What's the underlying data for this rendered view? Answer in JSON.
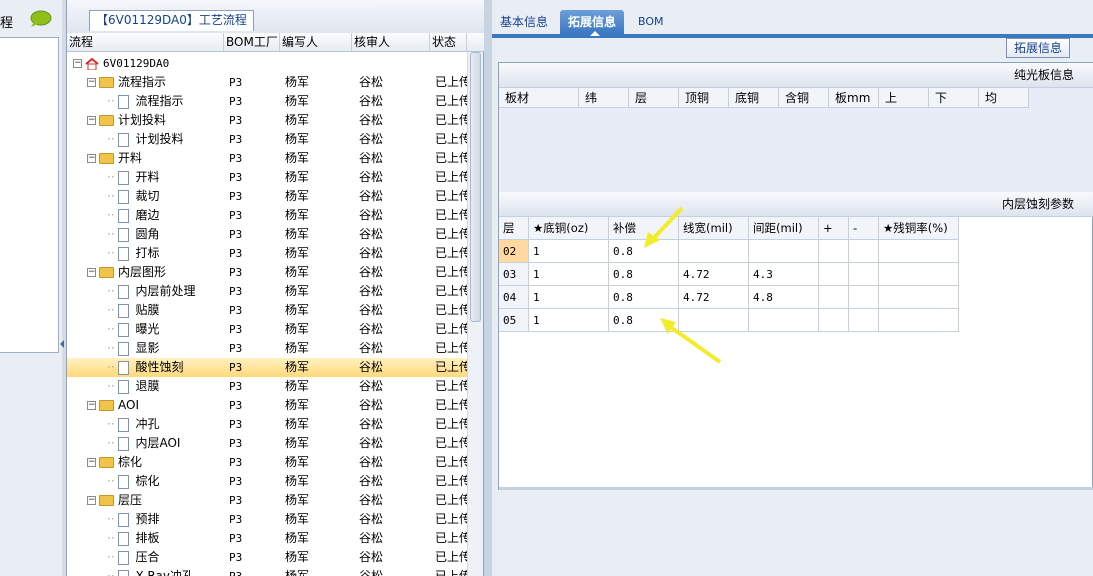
{
  "left_panel": {
    "label": "程",
    "chat_icon": "speech-bubble-icon"
  },
  "tree": {
    "title": "【6V01129DA0】工艺流程",
    "columns": [
      "流程",
      "BOM工厂",
      "编写人",
      "核审人",
      "状态"
    ],
    "root": "6V01129DA0",
    "rows": [
      {
        "label": "流程指示",
        "type": "folder",
        "bom": "P3",
        "author": "杨军",
        "reviewer": "谷松",
        "status": "已上传"
      },
      {
        "label": "流程指示",
        "type": "doc",
        "bom": "P3",
        "author": "杨军",
        "reviewer": "谷松",
        "status": "已上传"
      },
      {
        "label": "计划投料",
        "type": "folder",
        "bom": "P3",
        "author": "杨军",
        "reviewer": "谷松",
        "status": "已上传"
      },
      {
        "label": "计划投料",
        "type": "doc",
        "bom": "P3",
        "author": "杨军",
        "reviewer": "谷松",
        "status": "已上传"
      },
      {
        "label": "开料",
        "type": "folder",
        "bom": "P3",
        "author": "杨军",
        "reviewer": "谷松",
        "status": "已上传"
      },
      {
        "label": "开料",
        "type": "doc",
        "bom": "P3",
        "author": "杨军",
        "reviewer": "谷松",
        "status": "已上传"
      },
      {
        "label": "裁切",
        "type": "doc",
        "bom": "P3",
        "author": "杨军",
        "reviewer": "谷松",
        "status": "已上传"
      },
      {
        "label": "磨边",
        "type": "doc",
        "bom": "P3",
        "author": "杨军",
        "reviewer": "谷松",
        "status": "已上传"
      },
      {
        "label": "圆角",
        "type": "doc",
        "bom": "P3",
        "author": "杨军",
        "reviewer": "谷松",
        "status": "已上传"
      },
      {
        "label": "打标",
        "type": "doc",
        "bom": "P3",
        "author": "杨军",
        "reviewer": "谷松",
        "status": "已上传"
      },
      {
        "label": "内层图形",
        "type": "folder",
        "bom": "P3",
        "author": "杨军",
        "reviewer": "谷松",
        "status": "已上传"
      },
      {
        "label": "内层前处理",
        "type": "doc",
        "bom": "P3",
        "author": "杨军",
        "reviewer": "谷松",
        "status": "已上传"
      },
      {
        "label": "贴膜",
        "type": "doc",
        "bom": "P3",
        "author": "杨军",
        "reviewer": "谷松",
        "status": "已上传"
      },
      {
        "label": "曝光",
        "type": "doc",
        "bom": "P3",
        "author": "杨军",
        "reviewer": "谷松",
        "status": "已上传"
      },
      {
        "label": "显影",
        "type": "doc",
        "bom": "P3",
        "author": "杨军",
        "reviewer": "谷松",
        "status": "已上传"
      },
      {
        "label": "酸性蚀刻",
        "type": "doc",
        "bom": "P3",
        "author": "杨军",
        "reviewer": "谷松",
        "status": "已上传",
        "selected": true
      },
      {
        "label": "退膜",
        "type": "doc",
        "bom": "P3",
        "author": "杨军",
        "reviewer": "谷松",
        "status": "已上传"
      },
      {
        "label": "AOI",
        "type": "folder",
        "bom": "P3",
        "author": "杨军",
        "reviewer": "谷松",
        "status": "已上传"
      },
      {
        "label": "冲孔",
        "type": "doc",
        "bom": "P3",
        "author": "杨军",
        "reviewer": "谷松",
        "status": "已上传"
      },
      {
        "label": "内层AOI",
        "type": "doc",
        "bom": "P3",
        "author": "杨军",
        "reviewer": "谷松",
        "status": "已上传"
      },
      {
        "label": "棕化",
        "type": "folder",
        "bom": "P3",
        "author": "杨军",
        "reviewer": "谷松",
        "status": "已上传"
      },
      {
        "label": "棕化",
        "type": "doc",
        "bom": "P3",
        "author": "杨军",
        "reviewer": "谷松",
        "status": "已上传"
      },
      {
        "label": "层压",
        "type": "folder",
        "bom": "P3",
        "author": "杨军",
        "reviewer": "谷松",
        "status": "已上传"
      },
      {
        "label": "预排",
        "type": "doc",
        "bom": "P3",
        "author": "杨军",
        "reviewer": "谷松",
        "status": "已上传"
      },
      {
        "label": "排板",
        "type": "doc",
        "bom": "P3",
        "author": "杨军",
        "reviewer": "谷松",
        "status": "已上传"
      },
      {
        "label": "压合",
        "type": "doc",
        "bom": "P3",
        "author": "杨军",
        "reviewer": "谷松",
        "status": "已上传"
      },
      {
        "label": "X-Ray冲孔",
        "type": "doc",
        "bom": "P3",
        "author": "杨军",
        "reviewer": "谷松",
        "status": "已上传"
      }
    ]
  },
  "right": {
    "tabs": [
      "基本信息",
      "拓展信息",
      "BOM"
    ],
    "active_tab": 1,
    "ext_button": "拓展信息",
    "section1": {
      "title": "纯光板信息",
      "columns": [
        "板材",
        "纬",
        "层",
        "顶铜",
        "底铜",
        "含铜",
        "板mm",
        "上",
        "下",
        "均"
      ]
    },
    "section2": {
      "title": "内层蚀刻参数",
      "columns": [
        "层",
        "★底铜(oz)",
        "补偿",
        "线宽(mil)",
        "间距(mil)",
        "+",
        "-",
        "★残铜率(%)"
      ],
      "rows": [
        {
          "layer": "02",
          "base_cu": "1",
          "comp": "0.8",
          "width": "",
          "spacing": "",
          "plus": "",
          "minus": "",
          "residual": "",
          "highlight": true
        },
        {
          "layer": "03",
          "base_cu": "1",
          "comp": "0.8",
          "width": "4.72",
          "spacing": "4.3",
          "plus": "",
          "minus": "",
          "residual": ""
        },
        {
          "layer": "04",
          "base_cu": "1",
          "comp": "0.8",
          "width": "4.72",
          "spacing": "4.8",
          "plus": "",
          "minus": "",
          "residual": ""
        },
        {
          "layer": "05",
          "base_cu": "1",
          "comp": "0.8",
          "width": "",
          "spacing": "",
          "plus": "",
          "minus": "",
          "residual": ""
        }
      ]
    }
  },
  "annotation_color": "#f3ec2a"
}
